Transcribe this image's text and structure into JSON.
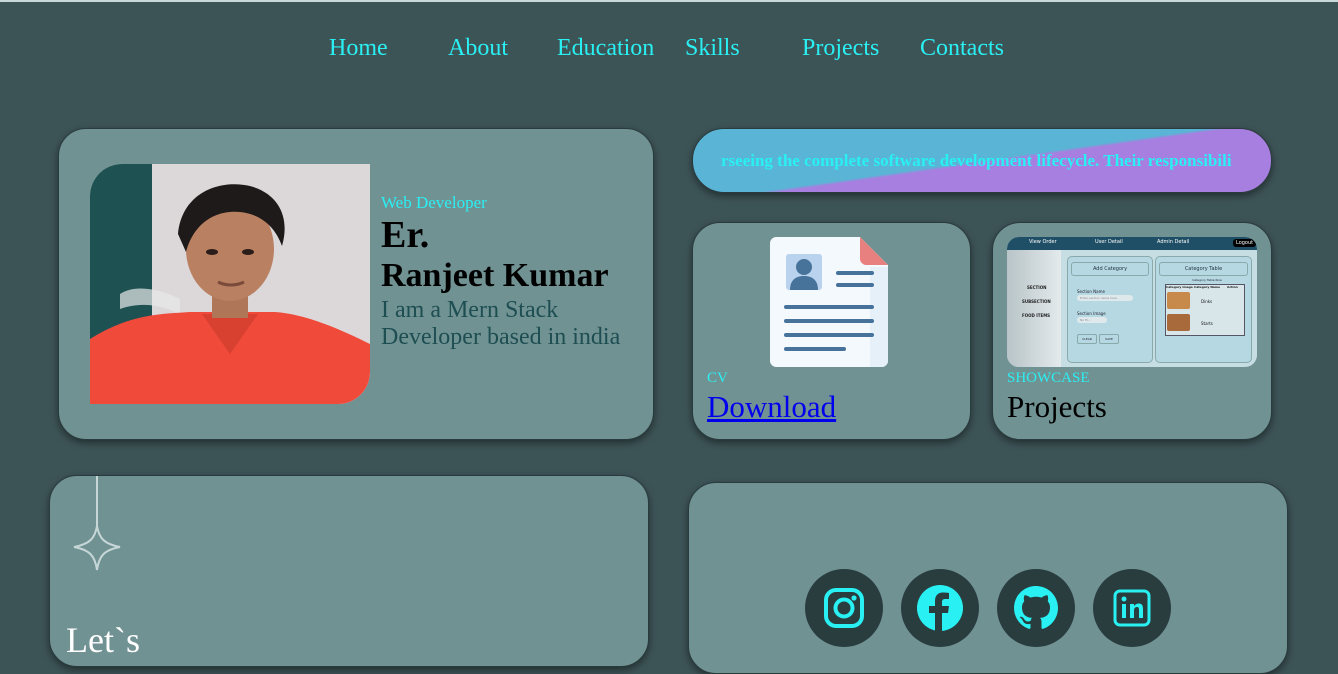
{
  "nav": {
    "items": [
      "Home",
      "About",
      "Education",
      "Skills",
      "Projects",
      "Contacts"
    ]
  },
  "hero": {
    "role": "Web Developer",
    "name_prefix": "Er.",
    "name": "Ranjeet Kumar",
    "intro": "I am a Mern Stack Developer based in india"
  },
  "marquee": {
    "text": "rseeing the complete software development lifecycle. Their responsibili"
  },
  "cv": {
    "label": "CV",
    "link": "Download",
    "icon": "resume-document-icon"
  },
  "projects": {
    "label": "SHOWCASE",
    "title": "Projects",
    "preview": {
      "topbar": [
        "View Order",
        "User Detail",
        "Admin Detail"
      ],
      "logout": "Logout",
      "sidebar": [
        "SECTION",
        "SUBSECTION",
        "FOOD ITEMS"
      ],
      "add_title": "Add Category",
      "field1_label": "Section Name",
      "field1_placeholder": "Enter section name here",
      "field2_label": "Section Image",
      "field2_placeholder": "No fil...",
      "buttons": [
        "CLEAR",
        "SAVE"
      ],
      "table_title": "Category Table",
      "table_sub": "Category Table Row",
      "table_headers": [
        "Category Image",
        "Category Name",
        "Action"
      ],
      "rows": [
        "Dinks",
        "Starts"
      ]
    }
  },
  "contact": {
    "heading": "Let`s"
  },
  "social": {
    "icons": [
      "instagram-icon",
      "facebook-icon",
      "github-icon",
      "linkedin-icon"
    ]
  },
  "colors": {
    "background": "#3d5457",
    "card": "#719293",
    "accent": "#29f0f3",
    "social_circle": "#293c3e"
  }
}
